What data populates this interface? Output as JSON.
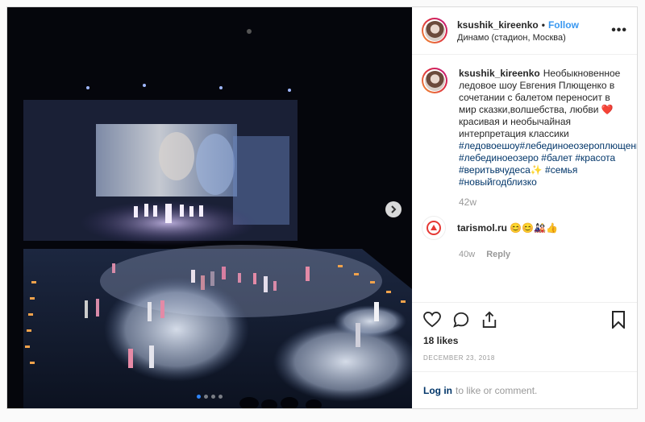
{
  "post": {
    "username": "ksushik_kireenko",
    "follow_label": "Follow",
    "bullet": "•",
    "location": "Динамо (стадион, Москва)",
    "more_label": "•••"
  },
  "caption": {
    "username": "ksushik_kireenko",
    "text": "Необыкновенное ледовое шоу Евгения Плющенко в сочетании с балетом переносит в мир сказки,волшебства, любви ❤️ красивая и необычайная интерпретация классики",
    "hashtags": "#ледовоешоу#лебединоеозероплющенко #лебединоеозеро #балет #красота #веритьвчудеса✨ #семья #новыйгодблизко",
    "time": "42w"
  },
  "comment": {
    "username": "tarismol.ru",
    "text": "😊😊🎎👍",
    "time": "40w",
    "reply_label": "Reply"
  },
  "engagement": {
    "likes": "18 likes",
    "date": "DECEMBER 23, 2018"
  },
  "footer": {
    "login_label": "Log in",
    "login_suffix": "to like or comment."
  },
  "carousel": {
    "total": 4,
    "active_index": 0
  },
  "colors": {
    "accent": "#3897f0",
    "hashtag": "#003569",
    "muted": "#999999",
    "heart": "#ed4956"
  }
}
